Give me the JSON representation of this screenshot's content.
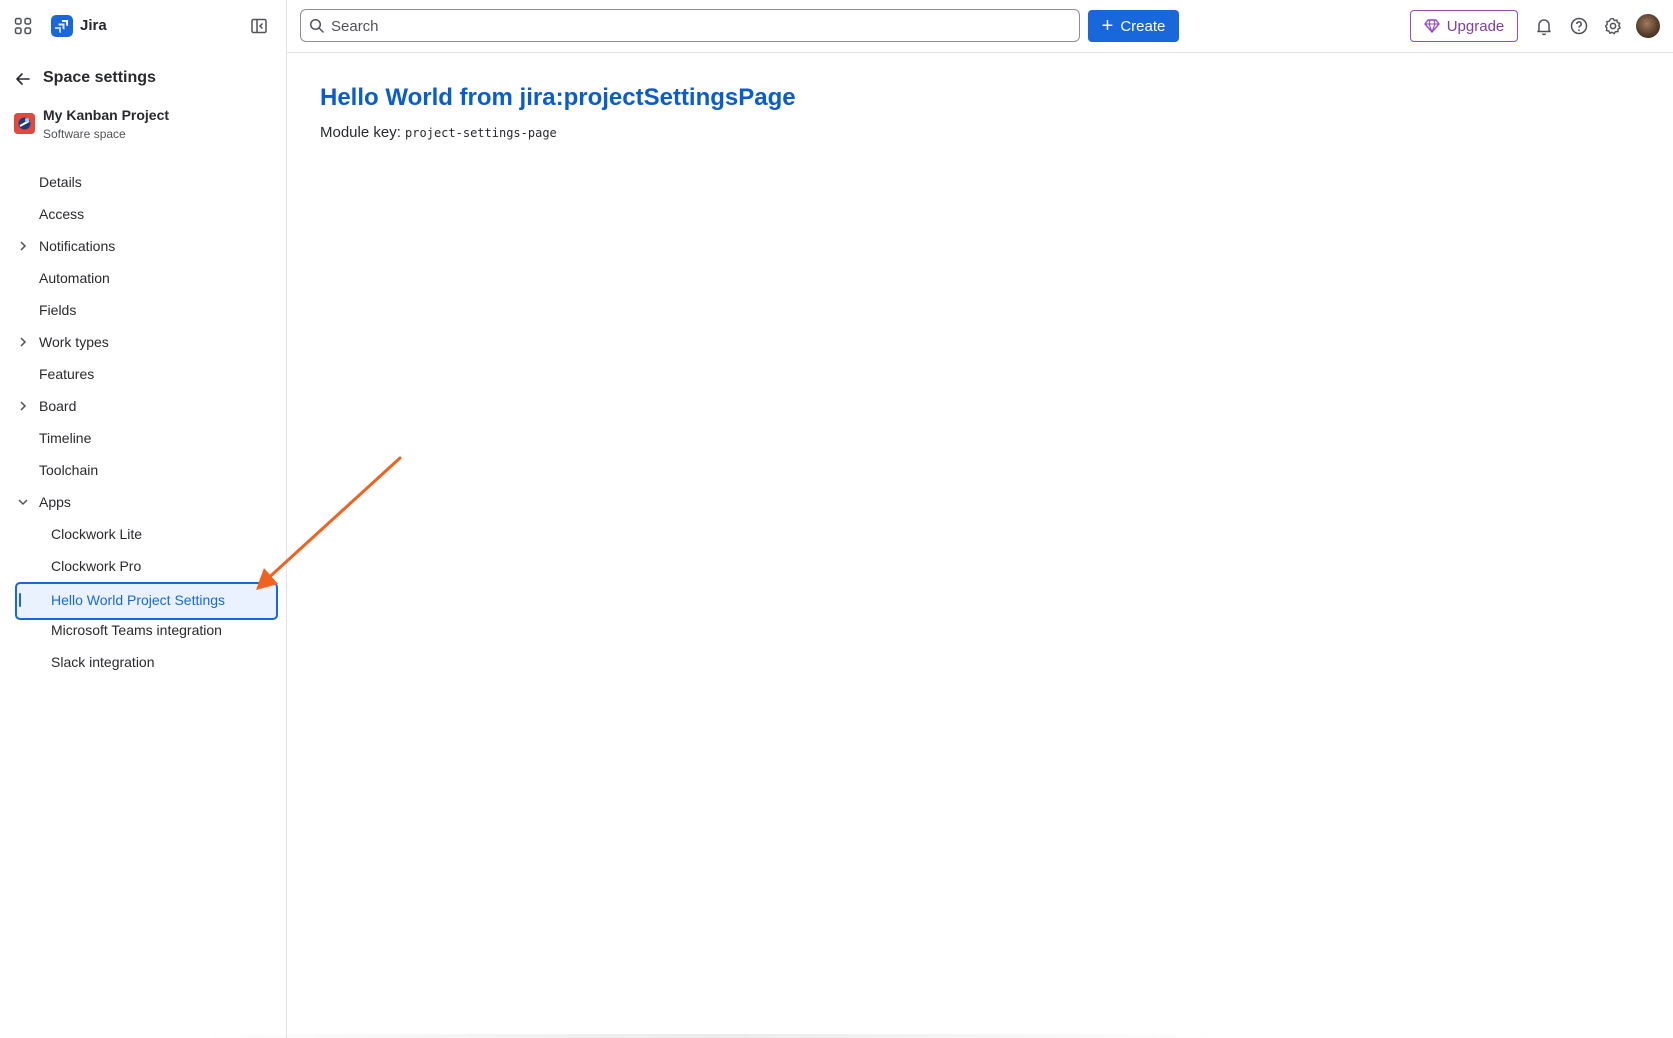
{
  "header": {
    "app_name": "Jira",
    "search_placeholder": "Search",
    "create_label": "Create",
    "upgrade_label": "Upgrade"
  },
  "sidebar": {
    "back_title": "Space settings",
    "project": {
      "name": "My Kanban Project",
      "type": "Software space"
    },
    "items": [
      {
        "label": "Details",
        "chevron": ""
      },
      {
        "label": "Access",
        "chevron": ""
      },
      {
        "label": "Notifications",
        "chevron": "right"
      },
      {
        "label": "Automation",
        "chevron": ""
      },
      {
        "label": "Fields",
        "chevron": ""
      },
      {
        "label": "Work types",
        "chevron": "right"
      },
      {
        "label": "Features",
        "chevron": ""
      },
      {
        "label": "Board",
        "chevron": "right"
      },
      {
        "label": "Timeline",
        "chevron": ""
      },
      {
        "label": "Toolchain",
        "chevron": ""
      },
      {
        "label": "Apps",
        "chevron": "down"
      }
    ],
    "app_items": [
      {
        "label": "Clockwork Lite"
      },
      {
        "label": "Clockwork Pro"
      },
      {
        "label": "Hello World Project Settings",
        "selected": true
      },
      {
        "label": "Microsoft Teams integration"
      },
      {
        "label": "Slack integration"
      }
    ]
  },
  "main": {
    "title": "Hello World from jira:projectSettingsPage",
    "module_key_label": "Module key:",
    "module_key_value": "project-settings-page"
  },
  "icons": {
    "app_switcher": "app-switcher-icon",
    "collapse": "sidebar-collapse-icon",
    "back": "arrow-left-icon",
    "search": "search-icon",
    "notifications": "bell-icon",
    "help": "question-icon",
    "settings": "gear-icon"
  },
  "colors": {
    "brand_blue": "#1868db",
    "title_blue": "#0b5ccc",
    "upgrade_purple": "#803fa5",
    "annotation_arrow": "#f0621e"
  }
}
